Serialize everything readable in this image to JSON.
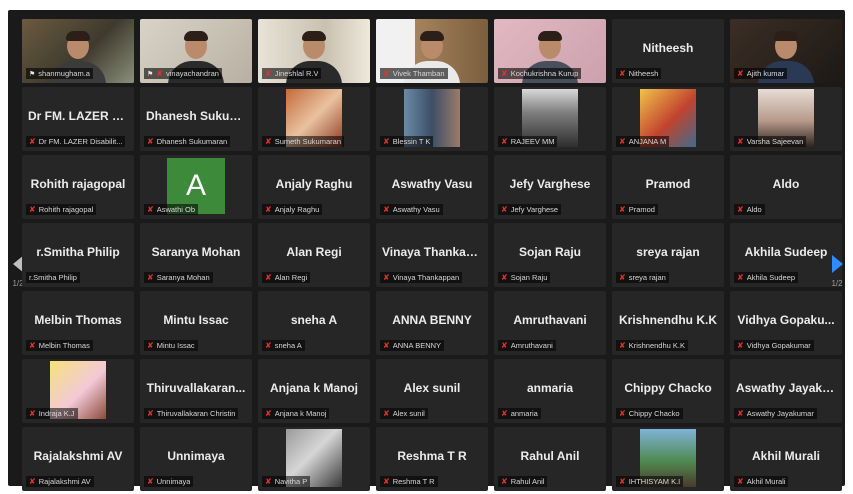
{
  "meeting": {
    "page_indicator_left": "1/2",
    "page_indicator_right": "1/2",
    "participants": [
      {
        "name": "",
        "label": "shanmugham.a",
        "video": true,
        "active": true,
        "pinned": true,
        "muted": false,
        "scene": "office"
      },
      {
        "name": "",
        "label": "vinayachandran",
        "video": true,
        "pinned": true,
        "muted": true,
        "scene": "room-light"
      },
      {
        "name": "",
        "label": "Jineshlal R.V",
        "video": true,
        "muted": true,
        "scene": "room-curtain"
      },
      {
        "name": "",
        "label": "Vivek Thamban",
        "video": true,
        "muted": true,
        "scene": "window"
      },
      {
        "name": "",
        "label": "Kochukrishna Kurup",
        "video": true,
        "muted": true,
        "scene": "pink-wall"
      },
      {
        "name": "Nitheesh",
        "label": "Nitheesh",
        "video": false,
        "muted": true
      },
      {
        "name": "",
        "label": "Ajith kumar",
        "video": true,
        "muted": true,
        "scene": "dark-room"
      },
      {
        "name": "Dr FM. LAZER D...",
        "label": "Dr FM. LAZER Disabilit...",
        "video": false,
        "muted": true
      },
      {
        "name": "Dhanesh Sukum...",
        "label": "Dhanesh Sukumaran",
        "video": false,
        "muted": true
      },
      {
        "name": "",
        "label": "Sumeth Sukumaran",
        "video": false,
        "photo": "warm",
        "muted": true
      },
      {
        "name": "",
        "label": "Blessin T K",
        "video": false,
        "photo": "duo",
        "muted": true
      },
      {
        "name": "",
        "label": "RAJEEV MM",
        "video": false,
        "photo": "suit",
        "muted": true
      },
      {
        "name": "",
        "label": "ANJANA M",
        "video": false,
        "photo": "child",
        "muted": true
      },
      {
        "name": "",
        "label": "Varsha Sajeevan",
        "video": false,
        "photo": "woman",
        "muted": true
      },
      {
        "name": "Rohith rajagopal",
        "label": "Rohith rajagopal",
        "video": false,
        "muted": true
      },
      {
        "name": "",
        "label": "Aswathi Ob",
        "video": false,
        "avatar_letter": "A",
        "muted": true
      },
      {
        "name": "Anjaly Raghu",
        "label": "Anjaly Raghu",
        "video": false,
        "muted": true
      },
      {
        "name": "Aswathy Vasu",
        "label": "Aswathy Vasu",
        "video": false,
        "muted": true
      },
      {
        "name": "Jefy Varghese",
        "label": "Jefy Varghese",
        "video": false,
        "muted": true
      },
      {
        "name": "Pramod",
        "label": "Pramod",
        "video": false,
        "muted": true
      },
      {
        "name": "Aldo",
        "label": "Aldo",
        "video": false,
        "muted": true
      },
      {
        "name": "r.Smitha Philip",
        "label": "r.Smitha Philip",
        "video": false,
        "muted": false
      },
      {
        "name": "Saranya Mohan",
        "label": "Saranya Mohan",
        "video": false,
        "muted": true
      },
      {
        "name": "Alan Regi",
        "label": "Alan Regi",
        "video": false,
        "muted": true
      },
      {
        "name": "Vinaya Thankap...",
        "label": "Vinaya Thankappan",
        "video": false,
        "muted": true
      },
      {
        "name": "Sojan Raju",
        "label": "Sojan Raju",
        "video": false,
        "muted": true
      },
      {
        "name": "sreya rajan",
        "label": "sreya rajan",
        "video": false,
        "muted": true
      },
      {
        "name": "Akhila Sudeep",
        "label": "Akhila Sudeep",
        "video": false,
        "muted": true
      },
      {
        "name": "Melbin Thomas",
        "label": "Melbin Thomas",
        "video": false,
        "muted": true
      },
      {
        "name": "Mintu Issac",
        "label": "Mintu Issac",
        "video": false,
        "muted": true
      },
      {
        "name": "sneha A",
        "label": "sneha A",
        "video": false,
        "muted": true
      },
      {
        "name": "ANNA BENNY",
        "label": "ANNA BENNY",
        "video": false,
        "muted": true
      },
      {
        "name": "Amruthavani",
        "label": "Amruthavani",
        "video": false,
        "muted": true
      },
      {
        "name": "Krishnendhu K.K",
        "label": "Krishnendhu K.K",
        "video": false,
        "muted": true
      },
      {
        "name": "Vidhya Gopaku...",
        "label": "Vidhya Gopakumar",
        "video": false,
        "muted": true
      },
      {
        "name": "",
        "label": "Indraja K.J",
        "video": false,
        "photo": "yellow",
        "muted": true
      },
      {
        "name": "Thiruvallakaran...",
        "label": "Thiruvallakaran Christin",
        "video": false,
        "muted": true
      },
      {
        "name": "Anjana k Manoj",
        "label": "Anjana k Manoj",
        "video": false,
        "muted": true
      },
      {
        "name": "Alex sunil",
        "label": "Alex sunil",
        "video": false,
        "muted": true
      },
      {
        "name": "anmaria",
        "label": "anmaria",
        "video": false,
        "muted": true
      },
      {
        "name": "Chippy Chacko",
        "label": "Chippy Chacko",
        "video": false,
        "muted": true
      },
      {
        "name": "Aswathy Jayaku...",
        "label": "Aswathy Jayakumar",
        "video": false,
        "muted": true
      },
      {
        "name": "Rajalakshmi AV",
        "label": "Rajalakshmi AV",
        "video": false,
        "muted": true
      },
      {
        "name": "Unnimaya",
        "label": "Unnimaya",
        "video": false,
        "muted": true
      },
      {
        "name": "",
        "label": "Navitha P",
        "video": false,
        "photo": "bw",
        "muted": true
      },
      {
        "name": "Reshma T R",
        "label": "Reshma T R",
        "video": false,
        "muted": true
      },
      {
        "name": "Rahul Anil",
        "label": "Rahul Anil",
        "video": false,
        "muted": true
      },
      {
        "name": "",
        "label": "IHTHISYAM K.I",
        "video": false,
        "photo": "outdoor",
        "muted": true
      },
      {
        "name": "Akhil Murali",
        "label": "Akhil Murali",
        "video": false,
        "muted": true
      }
    ]
  },
  "colors": {
    "tile_bg": "#262626",
    "active_border": "#b6c83a",
    "mute_red": "#e0332e",
    "next_arrow": "#2f8cff",
    "avatar_green": "#3c8a3a"
  }
}
